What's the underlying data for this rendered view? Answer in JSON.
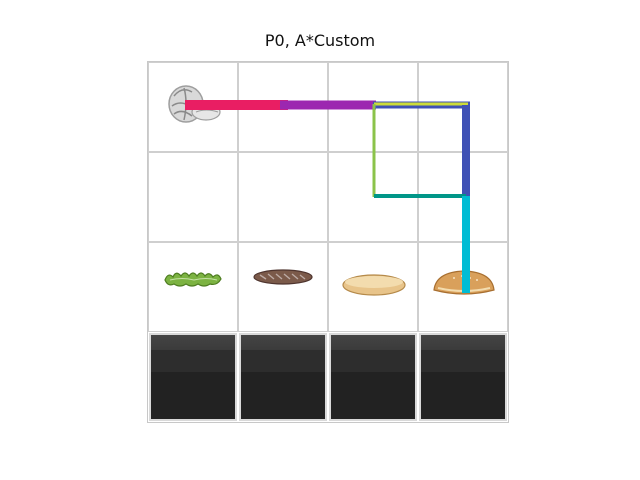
{
  "title": "P0, A*Custom",
  "grid": {
    "rows": 4,
    "cols": 4
  },
  "items": [
    {
      "name": "garlic-icon",
      "row": 0,
      "col": 0
    },
    {
      "name": "lettuce-icon",
      "row": 2,
      "col": 0
    },
    {
      "name": "patty-icon",
      "row": 2,
      "col": 1
    },
    {
      "name": "bottom-bun-icon",
      "row": 2,
      "col": 2
    },
    {
      "name": "top-bun-icon",
      "row": 2,
      "col": 3
    }
  ],
  "counters": [
    {
      "row": 3,
      "col": 0
    },
    {
      "row": 3,
      "col": 1
    },
    {
      "row": 3,
      "col": 2
    },
    {
      "row": 3,
      "col": 3
    }
  ],
  "colors": {
    "path_pink": "#e91e63",
    "path_purple": "#9c27b0",
    "path_indigo": "#3f51b5",
    "path_olive": "#cddc39",
    "path_green": "#8bc34a",
    "path_teal": "#009688",
    "path_cyan": "#00bcd4"
  }
}
